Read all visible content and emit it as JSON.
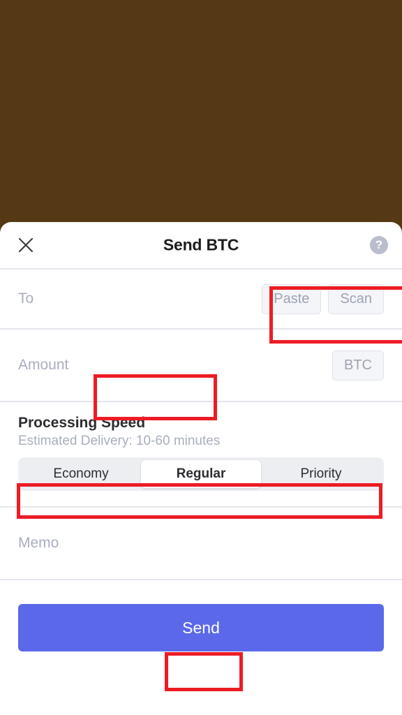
{
  "backdrop": {
    "color": "#543914"
  },
  "sheet": {
    "header": {
      "title": "Send BTC",
      "close_icon": "close-icon",
      "help_icon": "help-circle-icon",
      "help_glyph": "?"
    },
    "to_field": {
      "label": "To",
      "value": "",
      "placeholder": "",
      "paste_label": "Paste",
      "scan_label": "Scan"
    },
    "amount_field": {
      "label": "Amount",
      "value": "",
      "placeholder": "",
      "unit_label": "BTC"
    },
    "processing_speed": {
      "title": "Processing Speed",
      "subtitle": "Estimated Delivery: 10-60 minutes",
      "options": [
        {
          "label": "Economy",
          "selected": false
        },
        {
          "label": "Regular",
          "selected": true
        },
        {
          "label": "Priority",
          "selected": false
        }
      ],
      "selected": "Regular"
    },
    "memo_field": {
      "label": "Memo",
      "value": "",
      "placeholder": ""
    },
    "send_button": {
      "label": "Send",
      "color": "#5b68ea"
    }
  },
  "annotations": {
    "color": "#ed1c24",
    "boxes": [
      {
        "name": "paste-scan-highlight"
      },
      {
        "name": "amount-input-highlight"
      },
      {
        "name": "processing-speed-highlight"
      },
      {
        "name": "send-button-highlight"
      }
    ]
  }
}
